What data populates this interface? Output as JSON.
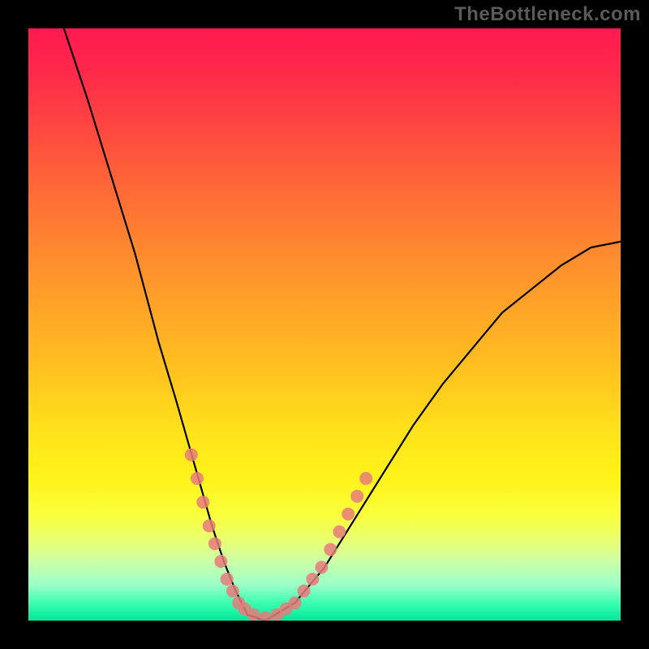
{
  "watermark": "TheBottleneck.com",
  "chart_data": {
    "type": "line",
    "title": "",
    "xlabel": "",
    "ylabel": "",
    "xlim": [
      0,
      100
    ],
    "ylim": [
      0,
      100
    ],
    "grid": false,
    "legend": false,
    "series": [
      {
        "name": "bottleneck-curve",
        "color": "#000000",
        "x": [
          6,
          10,
          14,
          18,
          22,
          25,
          27,
          29,
          31,
          33,
          35,
          37,
          40,
          45,
          50,
          55,
          60,
          65,
          70,
          75,
          80,
          85,
          90,
          95,
          100
        ],
        "y": [
          100,
          88,
          75,
          62,
          47,
          37,
          30,
          23,
          16,
          10,
          5,
          1,
          0,
          3,
          9,
          17,
          25,
          33,
          40,
          46,
          52,
          56,
          60,
          63,
          64
        ]
      }
    ],
    "markers": {
      "name": "highlighted-points",
      "color": "#e77b7b",
      "points": [
        {
          "x": 27.5,
          "y": 28
        },
        {
          "x": 28.5,
          "y": 24
        },
        {
          "x": 29.5,
          "y": 20
        },
        {
          "x": 30.5,
          "y": 16
        },
        {
          "x": 31.5,
          "y": 13
        },
        {
          "x": 32.5,
          "y": 10
        },
        {
          "x": 33.5,
          "y": 7
        },
        {
          "x": 34.5,
          "y": 5
        },
        {
          "x": 35.5,
          "y": 3
        },
        {
          "x": 36.5,
          "y": 2
        },
        {
          "x": 38.0,
          "y": 1
        },
        {
          "x": 40.0,
          "y": 0.5
        },
        {
          "x": 42.0,
          "y": 1
        },
        {
          "x": 43.5,
          "y": 2
        },
        {
          "x": 45.0,
          "y": 3
        },
        {
          "x": 46.5,
          "y": 5
        },
        {
          "x": 48.0,
          "y": 7
        },
        {
          "x": 49.5,
          "y": 9
        },
        {
          "x": 51.0,
          "y": 12
        },
        {
          "x": 52.5,
          "y": 15
        },
        {
          "x": 54.0,
          "y": 18
        },
        {
          "x": 55.5,
          "y": 21
        },
        {
          "x": 57.0,
          "y": 24
        }
      ]
    },
    "gradient_stops": [
      {
        "offset": 0,
        "color": "#ff1a4f"
      },
      {
        "offset": 50,
        "color": "#ffc21f"
      },
      {
        "offset": 80,
        "color": "#faff3a"
      },
      {
        "offset": 100,
        "color": "#00e69b"
      }
    ]
  }
}
